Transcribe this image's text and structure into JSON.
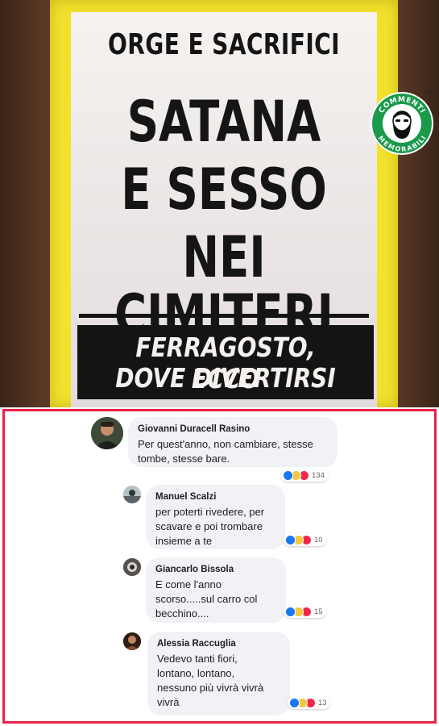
{
  "poster": {
    "kicker": "ORGE E SACRIFICI",
    "line1": "SATANA",
    "line2": "E SESSO",
    "line3": "NEI CIMITERI",
    "footer1": "FERRAGOSTO, ECCO",
    "footer2": "DOVE DIVERTIRSI"
  },
  "logo": {
    "top_text": "COMMENTI",
    "bottom_text": "MEMORABILI",
    "tm": "TM",
    "icon": "bearded-face-icon",
    "color": "#1a9a4a"
  },
  "colors": {
    "accent_border": "#e8234a",
    "bubble_bg": "#f0f2f5",
    "like": "#1877f2",
    "haha": "#f7c640",
    "love": "#f0284a"
  },
  "comments": [
    {
      "author": "Giovanni Duracell Rasino",
      "lines": [
        "Per quest'anno, non cambiare, stesse",
        "tombe, stesse bare."
      ],
      "reactions": [
        "like-icon",
        "haha-icon",
        "love-icon"
      ],
      "count": "134"
    },
    {
      "author": "Manuel Scalzi",
      "lines": [
        "per poterti rivedere, per",
        "scavare e poi trombare",
        "insieme a te"
      ],
      "reactions": [
        "like-icon",
        "haha-icon",
        "love-icon"
      ],
      "count": "10"
    },
    {
      "author": "Giancarlo Bissola",
      "lines": [
        "E come l'anno",
        "scorso.....sul carro col",
        "becchino...."
      ],
      "reactions": [
        "like-icon",
        "haha-icon",
        "love-icon"
      ],
      "count": "15"
    },
    {
      "author": "Alessia Raccuglia",
      "lines": [
        "Vedevo tanti fiori,",
        "lontano, lontano,",
        "nessuno più vivrà vivrà",
        "vivrà"
      ],
      "reactions": [
        "like-icon",
        "haha-icon",
        "love-icon"
      ],
      "count": "13"
    }
  ]
}
